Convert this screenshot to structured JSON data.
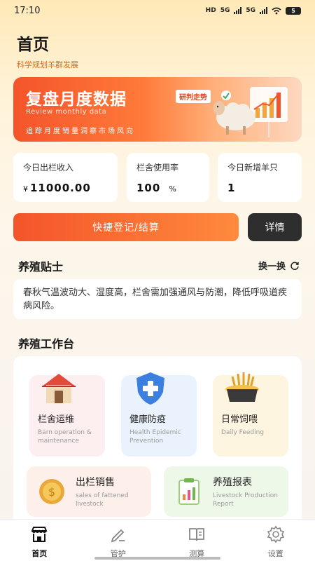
{
  "status_bar": {
    "time": "17:10",
    "network": "HD",
    "signal1": "5G",
    "signal2": "5G",
    "battery": "5"
  },
  "header": {
    "title": "首页",
    "subtitle": "科学规划羊群发展"
  },
  "banner": {
    "title": "复盘月度数据",
    "tag": "研判走势",
    "subtitle": "Review monthly data",
    "caption_chars": [
      "追",
      "踪",
      "月",
      "度",
      "销",
      "量",
      "洞",
      "察",
      "市",
      "场",
      "风",
      "向"
    ]
  },
  "stats": [
    {
      "label": "今日出栏收入",
      "prefix": "¥",
      "value": "11000.00",
      "unit": ""
    },
    {
      "label": "栏舍使用率",
      "prefix": "",
      "value": "100",
      "unit": "%"
    },
    {
      "label": "今日新增羊只",
      "prefix": "",
      "value": "1",
      "unit": ""
    }
  ],
  "actions": {
    "quick_label": "快捷登记/结算",
    "detail_label": "详情"
  },
  "tips": {
    "title": "养殖贴士",
    "refresh_label": "换一换",
    "content": "春秋气温波动大、湿度高，栏舍需加强通风与防潮，降低呼吸道疾病风险。"
  },
  "workbench": {
    "title": "养殖工作台",
    "tiles": [
      {
        "title": "栏舍运维",
        "en": "Barn operation & maintenance",
        "icon": "barn-icon",
        "bg": "#fdeef0"
      },
      {
        "title": "健康防疫",
        "en": "Health Epidemic Prevention",
        "icon": "medical-shield-icon",
        "bg": "#eaf3fd"
      },
      {
        "title": "日常饲喂",
        "en": "Daily Feeding",
        "icon": "feed-basket-icon",
        "bg": "#fdf5df"
      }
    ],
    "wide_tiles": [
      {
        "title": "出栏销售",
        "en": "sales of fattened livestock",
        "icon": "coin-icon",
        "bg": "#fdf0ea"
      },
      {
        "title": "养殖报表",
        "en": "Livestock Production Report",
        "icon": "report-icon",
        "bg": "#eef8e8"
      }
    ]
  },
  "bottom_nav": [
    {
      "label": "首页",
      "icon": "home-store-icon",
      "active": true
    },
    {
      "label": "管护",
      "icon": "pen-icon",
      "active": false
    },
    {
      "label": "测算",
      "icon": "book-icon",
      "active": false
    },
    {
      "label": "设置",
      "icon": "gear-icon",
      "active": false
    }
  ],
  "colors": {
    "accent": "#f4542a",
    "accent_light": "#ff8a3d",
    "dark_button": "#2e2e2e",
    "subtitle": "#e06a1a"
  }
}
